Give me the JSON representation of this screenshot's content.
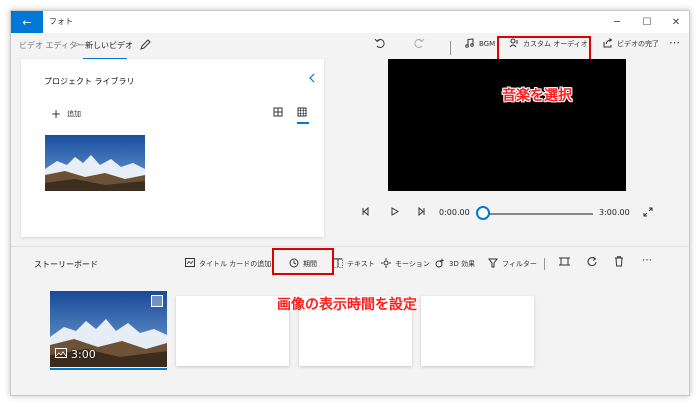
{
  "titlebar": {
    "title": "フォト",
    "back_glyph": "←",
    "minimize_glyph": "─",
    "maximize_glyph": "☐",
    "close_glyph": "✕"
  },
  "breadcrumb": {
    "parent": "ビデオ エディター",
    "separator": ">",
    "current": "新しいビデオ"
  },
  "toolbar": {
    "bgm_label": "BGM",
    "custom_audio_label": "カスタム オーディオ",
    "finish_label": "ビデオの完了"
  },
  "library": {
    "title": "プロジェクト ライブラリ",
    "add_label": "追加"
  },
  "player": {
    "current_time": "0:00.00",
    "total_time": "3:00.00",
    "progress": 0
  },
  "storyboard": {
    "title": "ストーリーボード",
    "add_title_card_label": "タイトル カードの追加",
    "duration_label": "期間",
    "text_label": "テキスト",
    "motion_label": "モーション",
    "effects_3d_label": "3D 効果",
    "filters_label": "フィルター",
    "clip_duration": "3:00"
  },
  "annotations": {
    "select_music": "音楽を選択",
    "set_image_duration": "画像の表示時間を設定",
    "box_color": "#e00000"
  },
  "colors": {
    "accent": "#0078d7",
    "preview_bg": "#000000",
    "annotation_text": "#ff1e1e"
  },
  "icons": {
    "undo": "undo-icon",
    "redo": "redo-icon",
    "music": "music-note-icon",
    "custom_audio": "custom-audio-icon",
    "share": "share-icon",
    "more": "more-icon",
    "pen": "pen-icon",
    "collapse": "chevron-left-icon",
    "grid_large": "large-grid-icon",
    "grid_small": "small-grid-icon"
  }
}
